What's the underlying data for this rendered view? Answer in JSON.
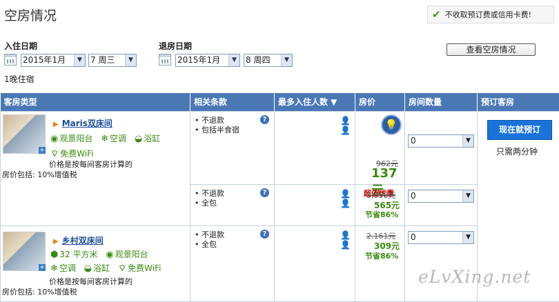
{
  "page": {
    "title": "空房情况",
    "nofee": "不收取预订费或信用卡费!"
  },
  "checkin": {
    "label": "入住日期",
    "month": "2015年1月",
    "day": "7 周三"
  },
  "checkout": {
    "label": "退房日期",
    "month": "2015年1月",
    "day": "8 周四"
  },
  "check_button": "查看空房情况",
  "nights": "1晚住宿",
  "table": {
    "headers": [
      "客房类型",
      "相关条款",
      "最多入住人数 ▼",
      "房价",
      "房间数量",
      "预订客房"
    ],
    "book_button": "现在就预订",
    "book_note": "只需两分钟"
  },
  "rooms": [
    {
      "name": "Maris双床间",
      "amenities": [
        "观景阳台",
        "空调",
        "浴缸",
        "免费WiFi"
      ],
      "note": "价格是按每间客房计算的",
      "includes": "房价包括: 10%增值税",
      "offers": [
        {
          "terms": [
            "不退款",
            "包括半食宿"
          ],
          "old": "962元",
          "new": "137元",
          "tag": "超值优惠",
          "qty": "0"
        },
        {
          "terms": [
            "不退款",
            "全包"
          ],
          "old": "3,956元",
          "new": "565元",
          "tag": "节省86%",
          "qty": "0"
        }
      ]
    },
    {
      "name": "乡村双床间",
      "amenities": [
        "32 平方米",
        "观景阳台",
        "空调",
        "浴缸",
        "免费WiFi"
      ],
      "note": "价格是按每间客房计算的",
      "includes": "房价包括: 10%增值税",
      "offers": [
        {
          "terms": [
            "不退款",
            "全包"
          ],
          "old": "2,161元",
          "new": "309元",
          "tag": "节省86%",
          "qty": "0"
        }
      ]
    }
  ],
  "watermark": "eLvXing.net"
}
